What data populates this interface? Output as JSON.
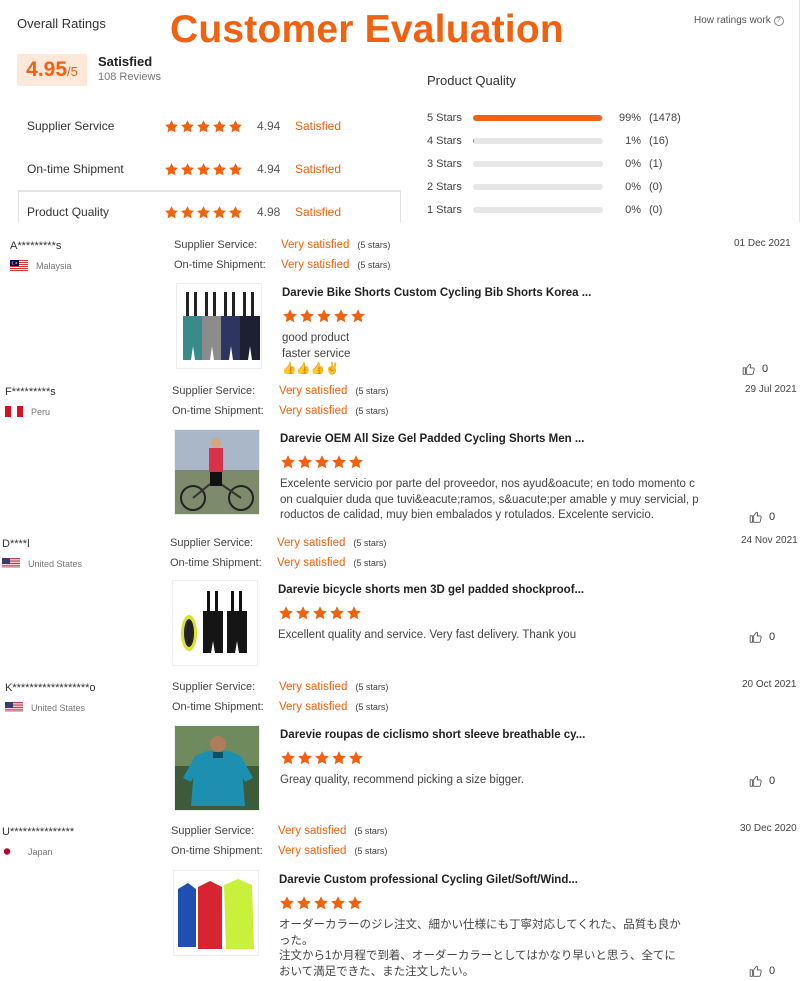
{
  "summary": {
    "overall_title": "Overall Ratings",
    "headline": "Customer Evaluation",
    "how_link": "How ratings work",
    "score": "4.95",
    "score_max": "/5",
    "score_text": "Satisfied",
    "reviews_count": "108 Reviews",
    "metrics": [
      {
        "label": "Supplier Service",
        "value": "4.94",
        "status": "Satisfied"
      },
      {
        "label": "On-time Shipment",
        "value": "4.94",
        "status": "Satisfied"
      },
      {
        "label": "Product Quality",
        "value": "4.98",
        "status": "Satisfied"
      }
    ],
    "distribution_title": "Product Quality",
    "distribution": [
      {
        "label": "5 Stars",
        "pct": "99%",
        "count": "(1478)",
        "fraction": 0.99
      },
      {
        "label": "4 Stars",
        "pct": "1%",
        "count": "(16)",
        "fraction": 0.01
      },
      {
        "label": "3 Stars",
        "pct": "0%",
        "count": "(1)",
        "fraction": 0
      },
      {
        "label": "2 Stars",
        "pct": "0%",
        "count": "(0)",
        "fraction": 0
      },
      {
        "label": "1 Stars",
        "pct": "0%",
        "count": "(0)",
        "fraction": 0
      }
    ]
  },
  "labels": {
    "supplier_service": "Supplier Service:",
    "ontime_shipment": "On-time Shipment:",
    "very_satisfied": "Very satisfied",
    "five_stars": "(5 stars)"
  },
  "colors": {
    "accent": "#f0620f",
    "star": "#f0620f"
  },
  "reviews": [
    {
      "user": "A*********s",
      "country": "Malaysia",
      "flag": "malaysia-flag",
      "date": "01 Dec 2021",
      "title": "Darevie Bike Shorts Custom Cycling Bib Shorts Korea ...",
      "text_lines": [
        "good product",
        "faster service",
        "👍👍👍✌"
      ],
      "likes": "0"
    },
    {
      "user": "F*********s",
      "country": "Peru",
      "flag": "peru-flag",
      "date": "29 Jul 2021",
      "title": "Darevie OEM All Size Gel Padded Cycling Shorts Men ...",
      "text_lines": [
        "Excelente servicio por parte del proveedor, nos ayud&oacute; en todo momento c",
        "on cualquier duda que tuvi&eacute;ramos, s&uacute;per amable y muy servicial, p",
        "roductos de calidad, muy bien embalados y rotulados. Excelente servicio."
      ],
      "likes": "0"
    },
    {
      "user": "D****l",
      "country": "United States",
      "flag": "usa-flag",
      "date": "24 Nov 2021",
      "title": "Darevie bicycle shorts men 3D gel padded shockproof...",
      "text_lines": [
        "Excellent quality and service. Very fast delivery. Thank you"
      ],
      "likes": "0"
    },
    {
      "user": "K******************o",
      "country": "United States",
      "flag": "usa-flag",
      "date": "20 Oct 2021",
      "title": "Darevie roupas de ciclismo short sleeve breathable cy...",
      "text_lines": [
        "Greay quality, recommend picking a size bigger."
      ],
      "likes": "0"
    },
    {
      "user": "U***************",
      "country": "Japan",
      "flag": "japan-flag",
      "date": "30 Dec 2020",
      "title": "Darevie Custom professional Cycling Gilet/Soft/Wind...",
      "text_lines": [
        "オーダーカラーのジレ注文、細かい仕様にも丁寧対応してくれた、品質も良か",
        "った。",
        "注文から1か月程で到着、オーダーカラーとしてはかなり早いと思う、全てに",
        "おいて満足できた、また注文したい。"
      ],
      "likes": "0"
    }
  ]
}
